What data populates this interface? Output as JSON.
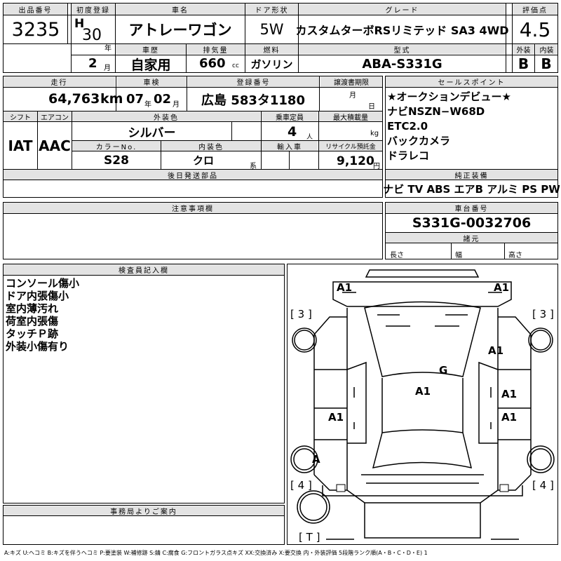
{
  "top": {
    "lot_label": "出品番号",
    "lot_value": "3235",
    "first_reg_label": "初度登録",
    "era": "H",
    "year": "30",
    "year_unit": "年",
    "month": "2",
    "month_unit": "月",
    "car_name_label": "車名",
    "car_name": "アトレーワゴン",
    "door_label": "ドア形状",
    "door": "5W",
    "grade_label": "グレード",
    "grade": "カスタムターボRSリミテッド SA3 4WD",
    "score_label": "評価点",
    "score": "4.5",
    "history_label": "車歴",
    "history": "自家用",
    "displacement_label": "排気量",
    "displacement": "660",
    "displacement_unit": "cc",
    "fuel_label": "燃料",
    "fuel": "ガソリン",
    "model_label": "型式",
    "model": "ABA-S331G",
    "exterior_label": "外装",
    "exterior": "B",
    "interior_label": "内装",
    "interior": "B"
  },
  "mid": {
    "mileage_label": "走行",
    "mileage": "64,763",
    "mileage_unit": "km",
    "inspection_label": "車検",
    "insp_year": "07",
    "insp_year_unit": "年",
    "insp_month": "02",
    "insp_month_unit": "月",
    "reg_no_label": "登録番号",
    "reg_no": "広島 583タ1180",
    "transfer_label": "譲渡書期限",
    "transfer_month": "月",
    "transfer_day": "日",
    "shift_label": "シフト",
    "shift": "IAT",
    "ac_label": "エアコン",
    "ac": "AAC",
    "ext_color_label": "外装色",
    "ext_color": "シルバー",
    "capacity_label": "乗車定員",
    "capacity": "4",
    "capacity_unit": "人",
    "max_load_label": "最大積載量",
    "max_load_unit": "kg",
    "color_no_label": "カラーNo.",
    "color_no": "S28",
    "int_color_label": "内装色",
    "int_color": "クロ",
    "int_color_unit": "系",
    "import_label": "輸入車",
    "recycle_label": "リサイクル預託金",
    "recycle": "9,120",
    "recycle_unit": "円",
    "later_parts_label": "後日発送部品"
  },
  "sales": {
    "label": "セールスポイント",
    "points": [
      "★オークションデビュー★",
      "ナビNSZN−W68D",
      "ETC2.0",
      "バックカメラ",
      "ドラレコ"
    ]
  },
  "equipment": {
    "label": "純正装備",
    "items": "ナビ TV ABS エアB アルミ PS PW"
  },
  "notes": {
    "label": "注意事項欄"
  },
  "chassis": {
    "label": "車台番号",
    "value": "S331G-0032706",
    "dims_label": "諸元",
    "length_label": "長さ",
    "width_label": "幅",
    "height_label": "高さ"
  },
  "inspector": {
    "label": "検査員記入欄",
    "lines": [
      "コンソール傷小",
      "ドア内張傷小",
      "室内薄汚れ",
      "荷室内張傷",
      "タッチＰ跡",
      "外装小傷有り"
    ]
  },
  "office": {
    "label": "事務局よりご案内"
  },
  "diagram": {
    "marks": [
      "A1",
      "A1",
      "A1",
      "G",
      "A1",
      "A1",
      "A1",
      "A1",
      "A"
    ],
    "tire_labels": [
      "3",
      "3",
      "4",
      "4",
      "T"
    ]
  },
  "legend": "A:キズ U:ヘコミ B:キズを伴うヘコミ P:要塗装 W:補修跡 S:錆 C:腐食 G:フロントガラス点キズ XX:交換済み X:要交換 内・外装評価 5段階ランク順(A・B・C・D・E) 1"
}
